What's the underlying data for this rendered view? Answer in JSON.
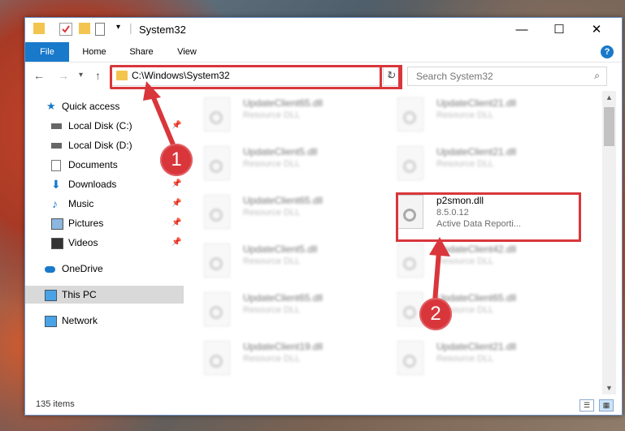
{
  "window": {
    "title": "System32",
    "controls": {
      "minimize": "—",
      "maximize": "☐",
      "close": "✕"
    }
  },
  "ribbon": {
    "tabs": [
      "File",
      "Home",
      "Share",
      "View"
    ],
    "help": "?"
  },
  "nav": {
    "address": "C:\\Windows\\System32",
    "search_placeholder": "Search System32"
  },
  "sidebar": {
    "items": [
      {
        "label": "Quick access",
        "icon": "star-icon"
      },
      {
        "label": "Local Disk (C:)",
        "icon": "drive-icon",
        "pinned": true
      },
      {
        "label": "Local Disk (D:)",
        "icon": "drive-icon"
      },
      {
        "label": "Documents",
        "icon": "documents-icon",
        "pinned": true
      },
      {
        "label": "Downloads",
        "icon": "downloads-icon",
        "pinned": true
      },
      {
        "label": "Music",
        "icon": "music-icon",
        "pinned": true
      },
      {
        "label": "Pictures",
        "icon": "pictures-icon",
        "pinned": true
      },
      {
        "label": "Videos",
        "icon": "videos-icon",
        "pinned": true
      },
      {
        "label": "OneDrive",
        "icon": "cloud-icon"
      },
      {
        "label": "This PC",
        "icon": "computer-icon",
        "selected": true
      },
      {
        "label": "Network",
        "icon": "network-icon"
      }
    ]
  },
  "files": {
    "left": [
      {
        "name": "UpdateClient65.dll",
        "desc": "Resource DLL"
      },
      {
        "name": "UpdateClient5.dll",
        "desc": "Resource DLL"
      },
      {
        "name": "UpdateClient65.dll",
        "desc": "Resource DLL"
      },
      {
        "name": "UpdateClient5.dll",
        "desc": "Resource DLL"
      },
      {
        "name": "UpdateClient65.dll",
        "desc": "Resource DLL"
      },
      {
        "name": "UpdateClient19.dll",
        "desc": "Resource DLL"
      }
    ],
    "right": [
      {
        "name": "UpdateClient21.dll",
        "desc": "Resource DLL"
      },
      {
        "name": "UpdateClient21.dll",
        "desc": "Resource DLL"
      },
      {
        "name": "p2smon.dll",
        "desc": "8.5.0.12",
        "desc2": "Active Data Reporti...",
        "selected": true
      },
      {
        "name": "UpdateClient42.dll",
        "desc": "Resource DLL"
      },
      {
        "name": "UpdateClient65.dll",
        "desc": "Resource DLL"
      },
      {
        "name": "UpdateClient21.dll",
        "desc": "Resource DLL"
      }
    ]
  },
  "status": {
    "item_count": "135 items"
  },
  "callouts": [
    "1",
    "2"
  ],
  "colors": {
    "accent": "#1979ca",
    "highlight": "#d9363b",
    "folder": "#f3c54e"
  }
}
